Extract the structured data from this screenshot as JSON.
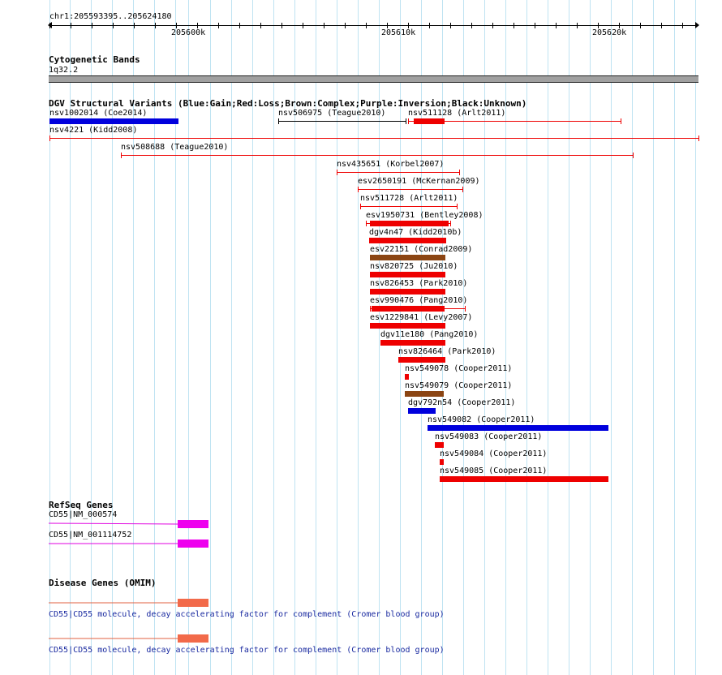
{
  "browser": {
    "location": "chr1:205593395..205624180",
    "ruler_ticks": [
      "205600k",
      "205610k",
      "205620k"
    ]
  },
  "cytoband": {
    "title": "Cytogenetic Bands",
    "band": "1q32.2"
  },
  "dgv": {
    "title": "DGV Structural Variants (Blue:Gain;Red:Loss;Brown:Complex;Purple:Inversion;Black:Unknown)",
    "colors": {
      "gain": "#0000dd",
      "loss": "#ee0000",
      "complex": "#8b4513",
      "inversion": "#800080",
      "unknown": "#000000"
    },
    "features": [
      {
        "label": "nsv1002014 (Coe2014)",
        "type": "gain",
        "style": "thick"
      },
      {
        "label": "nsv506975 (Teague2010)",
        "type": "unknown",
        "style": "thin"
      },
      {
        "label": "nsv511128 (Arlt2011)",
        "type": "loss",
        "style": "thin"
      },
      {
        "label": "nsv4221 (Kidd2008)",
        "type": "loss",
        "style": "thin"
      },
      {
        "label": "nsv508688 (Teague2010)",
        "type": "loss",
        "style": "thin"
      },
      {
        "label": "nsv435651 (Korbel2007)",
        "type": "loss",
        "style": "thin"
      },
      {
        "label": "esv2650191 (McKernan2009)",
        "type": "loss",
        "style": "thin"
      },
      {
        "label": "nsv511728 (Arlt2011)",
        "type": "loss",
        "style": "thin"
      },
      {
        "label": "esv1950731 (Bentley2008)",
        "type": "loss",
        "style": "thin"
      },
      {
        "label": "dgv4n47 (Kidd2010b)",
        "type": "loss",
        "style": "thick"
      },
      {
        "label": "esv22151 (Conrad2009)",
        "type": "complex",
        "style": "thick"
      },
      {
        "label": "nsv820725 (Ju2010)",
        "type": "loss",
        "style": "thick"
      },
      {
        "label": "nsv826453 (Park2010)",
        "type": "loss",
        "style": "thick"
      },
      {
        "label": "esv990476 (Pang2010)",
        "type": "loss",
        "style": "thin"
      },
      {
        "label": "esv1229841 (Levy2007)",
        "type": "loss",
        "style": "thick"
      },
      {
        "label": "dgv11e180 (Pang2010)",
        "type": "loss",
        "style": "thick"
      },
      {
        "label": "nsv826464 (Park2010)",
        "type": "loss",
        "style": "thick"
      },
      {
        "label": "nsv549078 (Cooper2011)",
        "type": "loss",
        "style": "thick"
      },
      {
        "label": "nsv549079 (Cooper2011)",
        "type": "complex",
        "style": "thick"
      },
      {
        "label": "dgv792n54 (Cooper2011)",
        "type": "gain",
        "style": "thick"
      },
      {
        "label": "nsv549082 (Cooper2011)",
        "type": "gain",
        "style": "thick"
      },
      {
        "label": "nsv549083 (Cooper2011)",
        "type": "loss",
        "style": "thick"
      },
      {
        "label": "nsv549084 (Cooper2011)",
        "type": "loss",
        "style": "thick"
      },
      {
        "label": "nsv549085 (Cooper2011)",
        "type": "loss",
        "style": "thick"
      }
    ]
  },
  "refseq": {
    "title": "RefSeq Genes",
    "color": "#ee00ee",
    "genes": [
      {
        "label": "CD55|NM_000574"
      },
      {
        "label": "CD55|NM_001114752"
      }
    ]
  },
  "omim": {
    "title": "Disease Genes (OMIM)",
    "color": "#f26a4a",
    "items": [
      {
        "label": "CD55|CD55 molecule, decay accelerating factor for complement (Cromer blood group)"
      },
      {
        "label": "CD55|CD55 molecule, decay accelerating factor for complement (Cromer blood group)"
      }
    ]
  }
}
